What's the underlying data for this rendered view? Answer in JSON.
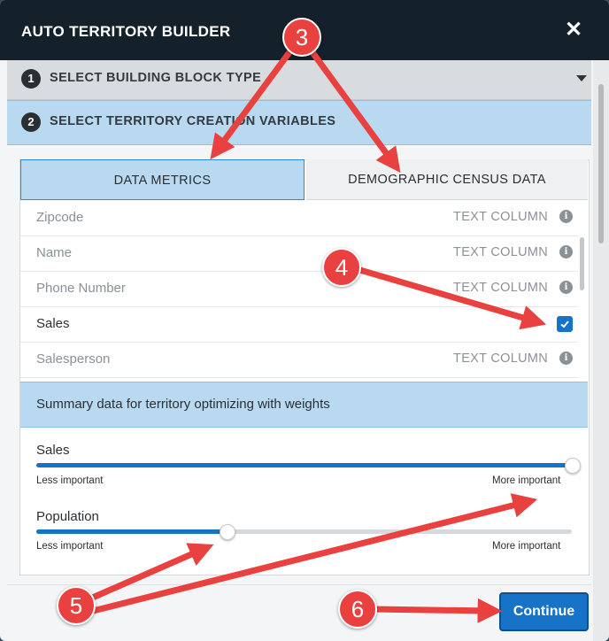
{
  "dialog": {
    "title": "AUTO TERRITORY BUILDER",
    "close_icon": "close-icon"
  },
  "steps": [
    {
      "number": "1",
      "label": "SELECT BUILDING BLOCK TYPE"
    },
    {
      "number": "2",
      "label": "SELECT TERRITORY CREATION VARIABLES"
    }
  ],
  "tabs": {
    "data_metrics": "DATA METRICS",
    "demographic": "DEMOGRAPHIC CENSUS DATA"
  },
  "columns": [
    {
      "name": "Zipcode",
      "type": "TEXT COLUMN"
    },
    {
      "name": "Name",
      "type": "TEXT COLUMN"
    },
    {
      "name": "Phone Number",
      "type": "TEXT COLUMN"
    },
    {
      "name": "Sales",
      "type": "",
      "checked": true
    },
    {
      "name": "Salesperson",
      "type": "TEXT COLUMN"
    }
  ],
  "summary": {
    "title": "Summary data for territory optimizing with weights"
  },
  "weights": [
    {
      "label": "Sales",
      "value": 1.0,
      "less": "Less important",
      "more": "More important"
    },
    {
      "label": "Population",
      "value": 0.355,
      "less": "Less important",
      "more": "More important"
    }
  ],
  "footer": {
    "continue_label": "Continue"
  },
  "annotations": [
    "3",
    "4",
    "5",
    "6"
  ],
  "colors": {
    "accent": "#1673c8",
    "titlebar": "#14202a",
    "highlight": "#b9d9f1",
    "annotation": "#e8413f"
  }
}
